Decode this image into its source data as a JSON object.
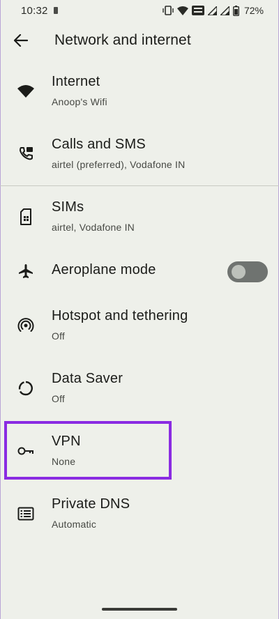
{
  "status_bar": {
    "time": "10:32",
    "battery": "72%"
  },
  "header": {
    "title": "Network and internet"
  },
  "items": [
    {
      "label": "Internet",
      "sub": "Anoop's Wifi",
      "icon": "wifi-icon"
    },
    {
      "label": "Calls and SMS",
      "sub": "airtel (preferred), Vodafone IN",
      "icon": "calls-sms-icon"
    },
    {
      "label": "SIMs",
      "sub": "airtel, Vodafone IN",
      "icon": "sim-card-icon"
    },
    {
      "label": "Aeroplane mode",
      "sub": "",
      "icon": "airplane-icon",
      "toggle_on": false
    },
    {
      "label": "Hotspot and tethering",
      "sub": "Off",
      "icon": "hotspot-icon"
    },
    {
      "label": "Data Saver",
      "sub": "Off",
      "icon": "data-saver-icon"
    },
    {
      "label": "VPN",
      "sub": "None",
      "icon": "key-icon",
      "highlighted": true
    },
    {
      "label": "Private DNS",
      "sub": "Automatic",
      "icon": "dns-icon"
    }
  ],
  "colors": {
    "background": "#eef0ea",
    "highlight": "#8a2be2",
    "toggle_track": "#6f7370"
  }
}
